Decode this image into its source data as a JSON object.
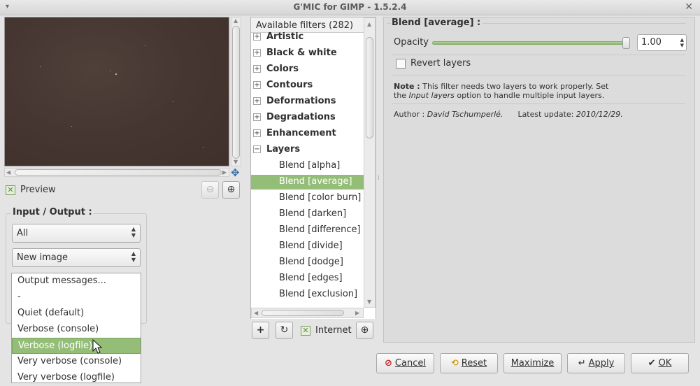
{
  "window": {
    "title": "G'MIC for GIMP - 1.5.2.4",
    "menu_glyph": "▾",
    "close_glyph": "✕"
  },
  "preview": {
    "label": "Preview",
    "checked": true,
    "zoom_out_glyph": "⊖",
    "zoom_in_glyph": "⊕"
  },
  "io": {
    "title": "Input / Output :",
    "input_layers": "All",
    "output_mode": "New image",
    "messages_menu": [
      "Output messages...",
      "-",
      "Quiet (default)",
      "Verbose (console)",
      "Verbose (logfile)",
      "Very verbose (console)",
      "Very verbose (logfile)"
    ],
    "selected_message": "Verbose (logfile)"
  },
  "filters": {
    "header": "Available filters (282) :",
    "categories": [
      "Artistic",
      "Black & white",
      "Colors",
      "Contours",
      "Deformations",
      "Degradations",
      "Enhancement"
    ],
    "open_category": "Layers",
    "layer_filters": [
      "Blend [alpha]",
      "Blend [average]",
      "Blend [color burn]",
      "Blend [darken]",
      "Blend [difference]",
      "Blend [divide]",
      "Blend [dodge]",
      "Blend [edges]",
      "Blend [exclusion]"
    ],
    "selected_filter": "Blend [average]",
    "internet_label": "Internet",
    "add_glyph": "+",
    "refresh_glyph": "↻"
  },
  "settings": {
    "title": "Blend [average] :",
    "opacity_label": "Opacity",
    "opacity_value": "1.00",
    "opacity_fraction": 1.0,
    "revert_label": "Revert layers",
    "revert_checked": false,
    "note_label": "Note :",
    "note_text_1": "This filter needs two layers to work properly. Set",
    "note_text_2a": "the",
    "note_text_2b": "Input layers",
    "note_text_2c": "option to handle multiple input layers.",
    "author_label": "Author :",
    "author_name": "David Tschumperlé.",
    "update_label": "Latest update:",
    "update_date": "2010/12/29."
  },
  "buttons": {
    "cancel": "Cancel",
    "reset": "Reset",
    "maximize": "Maximize",
    "apply": "Apply",
    "ok": "OK"
  }
}
